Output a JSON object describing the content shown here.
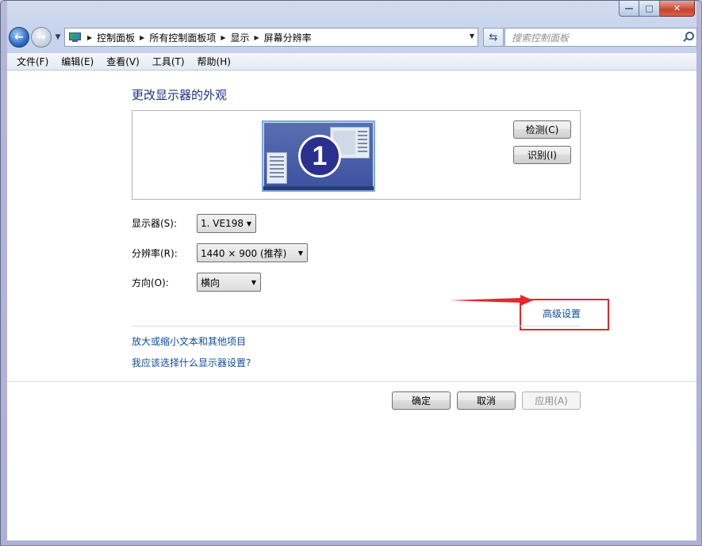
{
  "window": {
    "caption_buttons": {
      "minimize": "—",
      "maximize": "□",
      "close": "✕"
    }
  },
  "navbar": {
    "back_icon": "←",
    "forward_icon": "→",
    "breadcrumbs": [
      "控制面板",
      "所有控制面板项",
      "显示",
      "屏幕分辨率"
    ],
    "search_placeholder": "搜索控制面板"
  },
  "menu": {
    "items": [
      "文件(F)",
      "编辑(E)",
      "查看(V)",
      "工具(T)",
      "帮助(H)"
    ]
  },
  "main": {
    "title": "更改显示器的外观",
    "monitor_number": "1",
    "detect_label": "检测(C)",
    "identify_label": "识别(I)",
    "display_label": "显示器(S):",
    "display_value": "1. VE198",
    "resolution_label": "分辨率(R):",
    "resolution_value": "1440 × 900 (推荐)",
    "orientation_label": "方向(O):",
    "orientation_value": "横向",
    "advanced_link": "高级设置",
    "link_text_size": "放大或缩小文本和其他项目",
    "link_which_settings": "我应该选择什么显示器设置?"
  },
  "footer": {
    "ok_label": "确定",
    "cancel_label": "取消",
    "apply_label": "应用(A)"
  },
  "annotation": {
    "color": "#e8262a"
  }
}
